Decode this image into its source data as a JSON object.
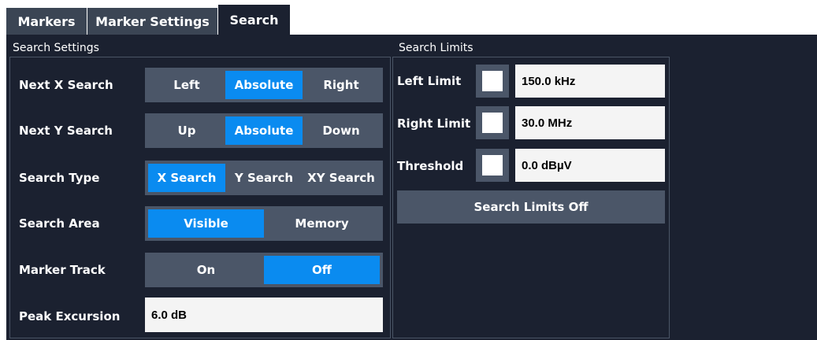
{
  "tabs": [
    {
      "label": "Markers"
    },
    {
      "label": "Marker Settings"
    },
    {
      "label": "Search"
    }
  ],
  "search_settings": {
    "title": "Search Settings",
    "next_x": {
      "label": "Next X Search",
      "options": [
        "Left",
        "Absolute",
        "Right"
      ],
      "selected": "Absolute"
    },
    "next_y": {
      "label": "Next Y Search",
      "options": [
        "Up",
        "Absolute",
        "Down"
      ],
      "selected": "Absolute"
    },
    "search_type": {
      "label": "Search Type",
      "options": [
        "X Search",
        "Y Search",
        "XY Search"
      ],
      "selected": "X Search"
    },
    "search_area": {
      "label": "Search Area",
      "options": [
        "Visible",
        "Memory"
      ],
      "selected": "Visible"
    },
    "marker_track": {
      "label": "Marker Track",
      "options": [
        "On",
        "Off"
      ],
      "selected": "Off"
    },
    "peak_excursion": {
      "label": "Peak Excursion",
      "value": "6.0 dB"
    }
  },
  "search_limits": {
    "title": "Search Limits",
    "left_limit": {
      "label": "Left Limit",
      "value": "150.0 kHz",
      "checked": false
    },
    "right_limit": {
      "label": "Right Limit",
      "value": "30.0 MHz",
      "checked": false
    },
    "threshold": {
      "label": "Threshold",
      "value": "0.0 dBµV",
      "checked": false
    },
    "off_button": "Search Limits Off"
  },
  "colors": {
    "panel": "#1b2130",
    "tab": "#3b4554",
    "control": "#4b5668",
    "selected": "#0a8bf0"
  }
}
